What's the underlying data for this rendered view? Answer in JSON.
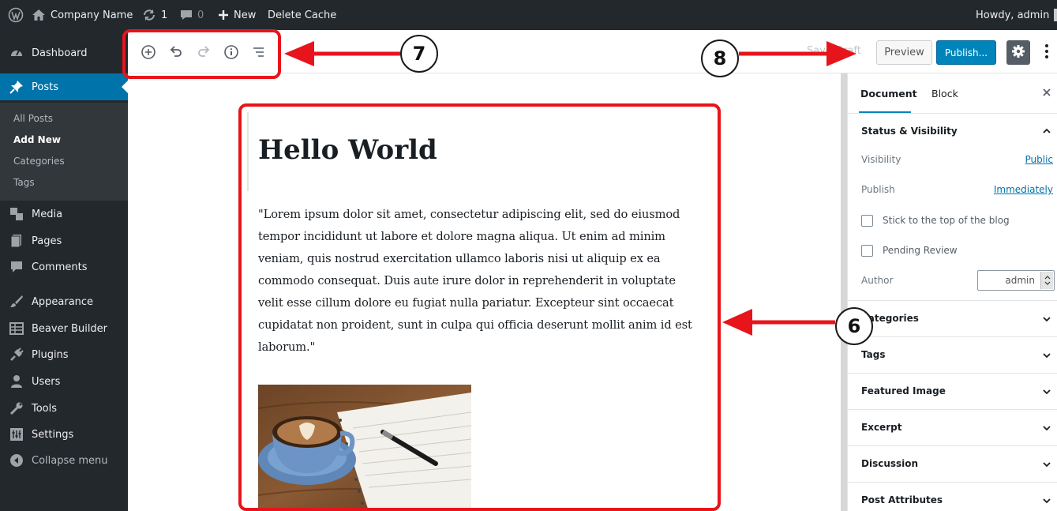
{
  "admin_bar": {
    "site_name": "Company Name",
    "updates_count": "1",
    "comments_count": "0",
    "new_label": "New",
    "delete_cache_label": "Delete Cache",
    "howdy_label": "Howdy, admin"
  },
  "sidebar": {
    "items": [
      {
        "label": "Dashboard",
        "icon": "dashboard-icon"
      },
      {
        "label": "Posts",
        "icon": "pin-icon"
      },
      {
        "label": "Media",
        "icon": "media-icon"
      },
      {
        "label": "Pages",
        "icon": "pages-icon"
      },
      {
        "label": "Comments",
        "icon": "comment-icon"
      },
      {
        "label": "Appearance",
        "icon": "brush-icon"
      },
      {
        "label": "Beaver Builder",
        "icon": "grid-icon"
      },
      {
        "label": "Plugins",
        "icon": "plug-icon"
      },
      {
        "label": "Users",
        "icon": "user-icon"
      },
      {
        "label": "Tools",
        "icon": "wrench-icon"
      },
      {
        "label": "Settings",
        "icon": "settings-icon"
      },
      {
        "label": "Collapse menu",
        "icon": "collapse-icon"
      }
    ],
    "submenu": [
      "All Posts",
      "Add New",
      "Categories",
      "Tags"
    ]
  },
  "toolbar": {
    "icons": [
      "add-block-icon",
      "undo-icon",
      "redo-icon",
      "info-icon",
      "outline-icon"
    ],
    "save_draft_label": "Save Draft",
    "preview_label": "Preview",
    "publish_label": "Publish..."
  },
  "post": {
    "title": "Hello World",
    "paragraph_lines": [
      "\"Lorem ipsum dolor sit amet, consectetur adipiscing elit, sed do eiusmod",
      "tempor incididunt ut labore et dolore magna aliqua. Ut enim ad minim",
      "veniam, quis nostrud exercitation ullamco laboris nisi ut aliquip ex ea",
      "commodo consequat. Duis aute irure dolor in reprehenderit in voluptate",
      "velit esse cillum dolore eu fugiat nulla pariatur. Excepteur sint occaecat",
      "cupidatat non proident, sunt in culpa qui officia deserunt mollit anim id est",
      "laborum.\""
    ]
  },
  "panel": {
    "tab_document": "Document",
    "tab_block": "Block",
    "status_visibility": "Status & Visibility",
    "visibility_label": "Visibility",
    "visibility_value": "Public",
    "publish_label": "Publish",
    "publish_value": "Immediately",
    "stick_label": "Stick to the top of the blog",
    "pending_label": "Pending Review",
    "author_label": "Author",
    "author_value": "admin",
    "sections": [
      "Categories",
      "Tags",
      "Featured Image",
      "Excerpt",
      "Discussion",
      "Post Attributes"
    ]
  },
  "annotations": {
    "callout_7": "7",
    "callout_8": "8",
    "callout_6": "6",
    "annotation_color": "#e8141b"
  },
  "colors": {
    "admin_bar": "#23282d",
    "accent_blue": "#0073aa",
    "publish_blue": "#0085ba"
  }
}
